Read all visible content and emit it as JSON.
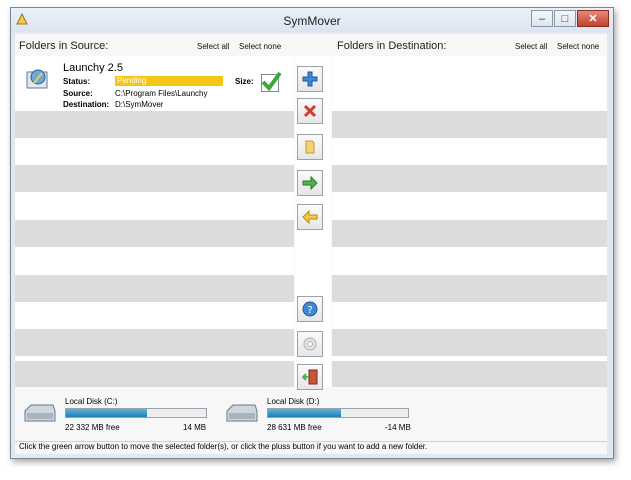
{
  "window": {
    "title": "SymMover"
  },
  "source": {
    "header": "Folders in Source:",
    "select_all": "Select all",
    "select_none": "Select none",
    "item": {
      "name": "Launchy 2.5",
      "status_label": "Status:",
      "status_value": "Pending",
      "source_label": "Source:",
      "source_value": "C:\\Program Files\\Launchy",
      "destination_label": "Destination:",
      "destination_value": "D:\\SymMover",
      "size_label": "Size:"
    }
  },
  "destination": {
    "header": "Folders in Destination:",
    "select_all": "Select all",
    "select_none": "Select none"
  },
  "toolbar": {
    "icons": [
      "add-icon",
      "delete-icon",
      "folder-icon",
      "move-right-icon",
      "move-left-icon",
      "help-icon",
      "settings-icon",
      "exit-icon"
    ]
  },
  "disks": [
    {
      "label": "Local Disk (C:)",
      "free": "22 332 MB free",
      "change": "14 MB",
      "used_fraction": 0.58
    },
    {
      "label": "Local Disk (D:)",
      "free": "28 631 MB free",
      "change": "-14 MB",
      "used_fraction": 0.52
    }
  ],
  "status_bar": {
    "text": "Click the green arrow button to move the selected folder(s), or click the pluss button if you want to add a new folder."
  },
  "colors": {
    "pending": "#f5c518",
    "disk_fill": "#2e8fc4",
    "check": "#3aa83a"
  }
}
